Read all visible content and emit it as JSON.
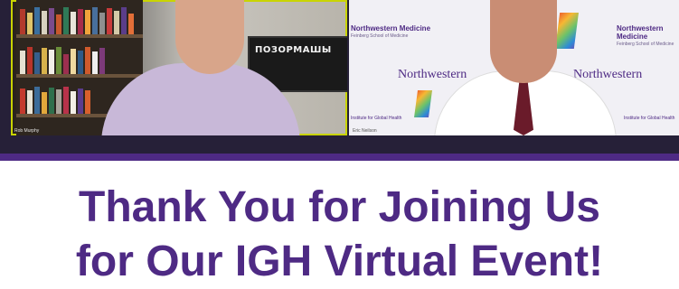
{
  "participants": [
    {
      "name": "Rob Murphy"
    },
    {
      "name": "Eric Neilson"
    }
  ],
  "background_text": {
    "logo_name": "Northwestern Medicine",
    "logo_subtitle": "Feinberg School of Medicine",
    "wordmark": "Northwestern",
    "institute": "Institute for Global Health",
    "poster": "ПОЗОРМАШЫ"
  },
  "heading": {
    "line1": "Thank You for Joining Us",
    "line2": "for Our IGH Virtual Event!"
  },
  "colors": {
    "brand_purple": "#4e2a84",
    "active_speaker_border": "#c9d400"
  }
}
